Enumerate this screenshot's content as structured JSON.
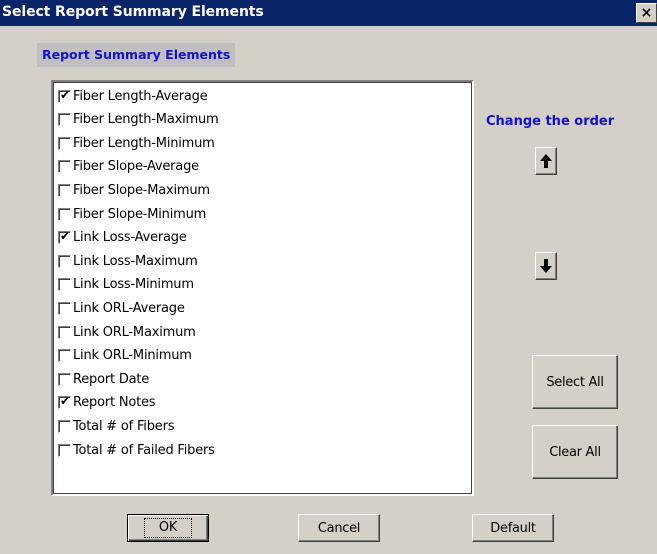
{
  "window": {
    "title": "Select Report Summary Elements",
    "close_label": "×"
  },
  "group": {
    "label": "Report Summary Elements"
  },
  "list": {
    "items": [
      {
        "label": "Fiber Length-Average",
        "checked": true
      },
      {
        "label": "Fiber Length-Maximum",
        "checked": false
      },
      {
        "label": "Fiber Length-Minimum",
        "checked": false
      },
      {
        "label": "Fiber Slope-Average",
        "checked": false
      },
      {
        "label": "Fiber Slope-Maximum",
        "checked": false
      },
      {
        "label": "Fiber Slope-Minimum",
        "checked": false
      },
      {
        "label": "Link Loss-Average",
        "checked": true
      },
      {
        "label": "Link Loss-Maximum",
        "checked": false
      },
      {
        "label": "Link Loss-Minimum",
        "checked": false
      },
      {
        "label": "Link ORL-Average",
        "checked": false
      },
      {
        "label": "Link ORL-Maximum",
        "checked": false
      },
      {
        "label": "Link ORL-Minimum",
        "checked": false
      },
      {
        "label": "Report Date",
        "checked": false
      },
      {
        "label": "Report Notes",
        "checked": true
      },
      {
        "label": "Total # of Fibers",
        "checked": false
      },
      {
        "label": "Total # of Failed Fibers",
        "checked": false
      }
    ]
  },
  "order": {
    "label": "Change the order",
    "up_icon": "up-arrow-icon",
    "down_icon": "down-arrow-icon"
  },
  "buttons": {
    "select_all": "Select All",
    "clear_all": "Clear All",
    "ok": "OK",
    "cancel": "Cancel",
    "default": "Default"
  },
  "colors": {
    "titlebar": "#0a246a",
    "accent_text": "#1111cc",
    "dialog_bg": "#d4d0c8"
  }
}
